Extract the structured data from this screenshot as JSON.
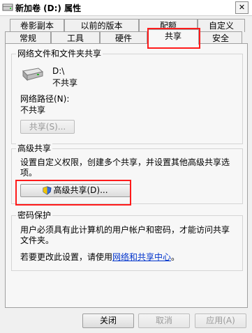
{
  "window": {
    "title": "新加卷 (D:) 属性",
    "close_label": "✕"
  },
  "tabs_row1": [
    "卷影副本",
    "以前的版本",
    "配额",
    "自定义"
  ],
  "tabs_row2": [
    "常规",
    "工具",
    "硬件",
    "共享",
    "安全"
  ],
  "active_tab": "共享",
  "network_sharing": {
    "title": "网络文件和文件夹共享",
    "drive_path": "D:\\",
    "status": "不共享",
    "network_path_label": "网络路径(N):",
    "network_path_value": "不共享",
    "share_button": "共享(S)..."
  },
  "advanced_sharing": {
    "title": "高级共享",
    "description_line1": "设置自定义权限，创建多个共享，并设置其他高级共享选",
    "description_line2": "项。",
    "button": "高级共享(D)..."
  },
  "password_protection": {
    "title": "密码保护",
    "line1": "用户必须具有此计算机的用户帐户和密码，才能访问共享",
    "line2": "文件夹。",
    "change_prefix": "若要更改此设置，请使用",
    "change_link": "网络和共享中心",
    "change_suffix": "。"
  },
  "footer": {
    "close": "关闭",
    "cancel": "取消",
    "apply": "应用(A)"
  },
  "colors": {
    "highlight": "#ff1a1a",
    "link": "#0033cc",
    "disabled_text": "#9a9a9a"
  }
}
